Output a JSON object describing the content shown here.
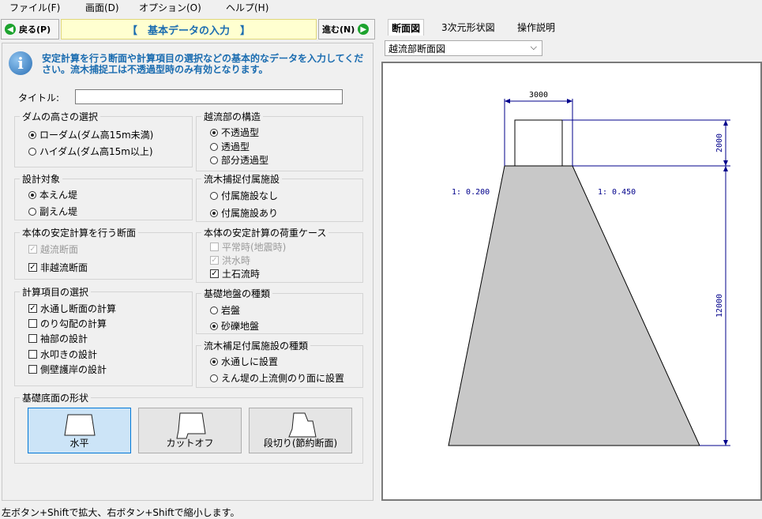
{
  "menu": {
    "file": "ファイル(F)",
    "view": "画面(D)",
    "options": "オプション(O)",
    "help": "ヘルプ(H)"
  },
  "toolbar": {
    "back": "戻る(P)",
    "title": "【　基本データの入力　】",
    "next": "進む(N)"
  },
  "info": "安定計算を行う断面や計算項目の選択などの基本的なデータを入力してください。流木捕捉工は不透過型時のみ有効となります。",
  "title_label": "タイトル:",
  "title_value": "",
  "groups": {
    "dam_height": {
      "title": "ダムの高さの選択",
      "options": [
        "ローダム(ダム高15m未満)",
        "ハイダム(ダム高15m以上)"
      ]
    },
    "overflow_structure": {
      "title": "越流部の構造",
      "options": [
        "不透過型",
        "透過型",
        "部分透過型"
      ]
    },
    "design_target": {
      "title": "設計対象",
      "options": [
        "本えん堤",
        "副えん堤"
      ]
    },
    "driftwood_facility": {
      "title": "流木捕捉付属施設",
      "options": [
        "付属施設なし",
        "付属施設あり"
      ]
    },
    "section": {
      "title": "本体の安定計算を行う断面",
      "options": [
        "越流断面",
        "非越流断面"
      ]
    },
    "load_case": {
      "title": "本体の安定計算の荷重ケース",
      "options": [
        "平常時(地震時)",
        "洪水時",
        "土石流時"
      ]
    },
    "calc_items": {
      "title": "計算項目の選択",
      "options": [
        "水通し断面の計算",
        "のり勾配の計算",
        "袖部の設計",
        "水叩きの設計",
        "側壁護岸の設計"
      ]
    },
    "foundation": {
      "title": "基礎地盤の種類",
      "options": [
        "岩盤",
        "砂礫地盤"
      ]
    },
    "facility_type": {
      "title": "流木補足付属施設の種類",
      "options": [
        "水通しに設置",
        "えん堤の上流側のり面に設置"
      ]
    },
    "base_shape": {
      "title": "基礎底面の形状",
      "options": [
        "水平",
        "カットオフ",
        "段切り(節約断面)"
      ]
    }
  },
  "right": {
    "tabs": [
      "断面図",
      "3次元形状図",
      "操作説明"
    ],
    "select": "越流部断面図",
    "drawing": {
      "top_width": "3000",
      "crest_height": "2000",
      "body_height": "12000",
      "upstream_slope": "1: 0.200",
      "downstream_slope": "1: 0.450"
    }
  },
  "status": "左ボタン+Shiftで拡大、右ボタン+Shiftで縮小します。"
}
